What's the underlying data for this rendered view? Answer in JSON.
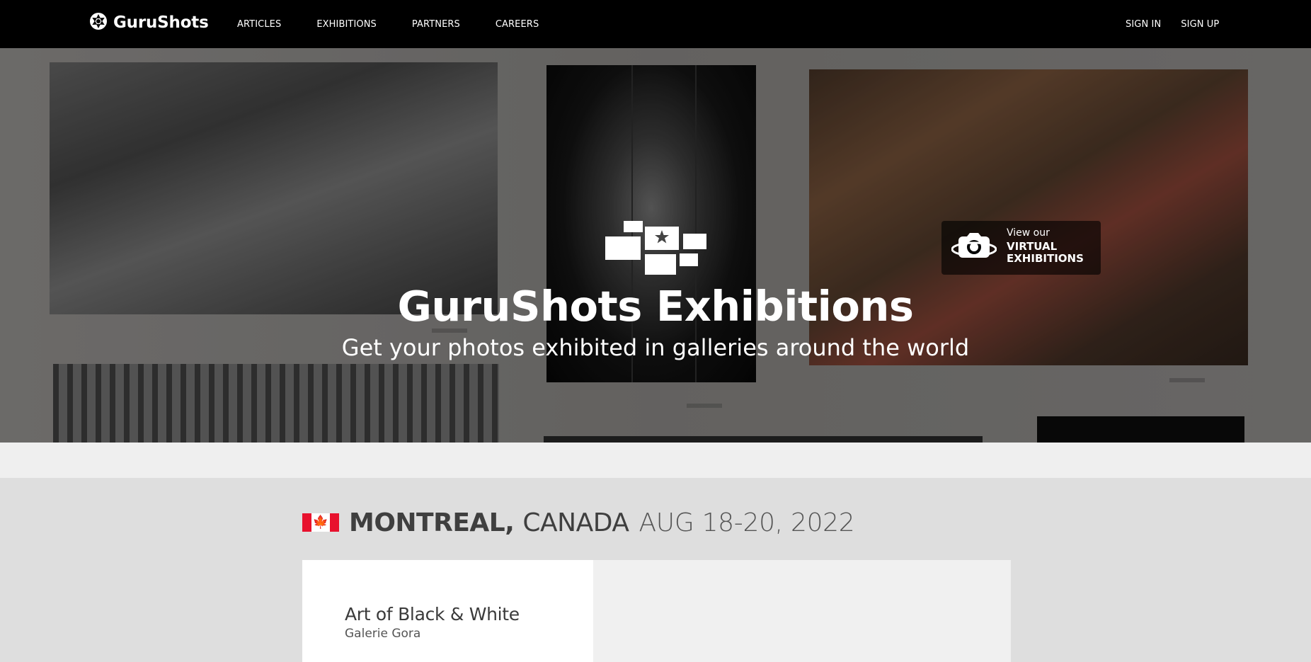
{
  "header": {
    "logo_text": "GuruShots",
    "nav_left": [
      "ARTICLES",
      "EXHIBITIONS",
      "PARTNERS",
      "CAREERS"
    ],
    "nav_right": [
      "SIGN IN",
      "SIGN UP"
    ]
  },
  "hero": {
    "title": "GuruShots Exhibitions",
    "subtitle": "Get your photos exhibited in galleries around the world",
    "virtual_small": "View our",
    "virtual_big_line1": "VIRTUAL",
    "virtual_big_line2": "EXHIBITIONS"
  },
  "exhibition": {
    "flag_icon": "canada-flag-icon",
    "city": "MONTREAL,",
    "country": "CANADA",
    "dates": "AUG 18-20, 2022",
    "card": {
      "title": "Art of Black & White",
      "gallery": "Galerie Gora"
    }
  }
}
